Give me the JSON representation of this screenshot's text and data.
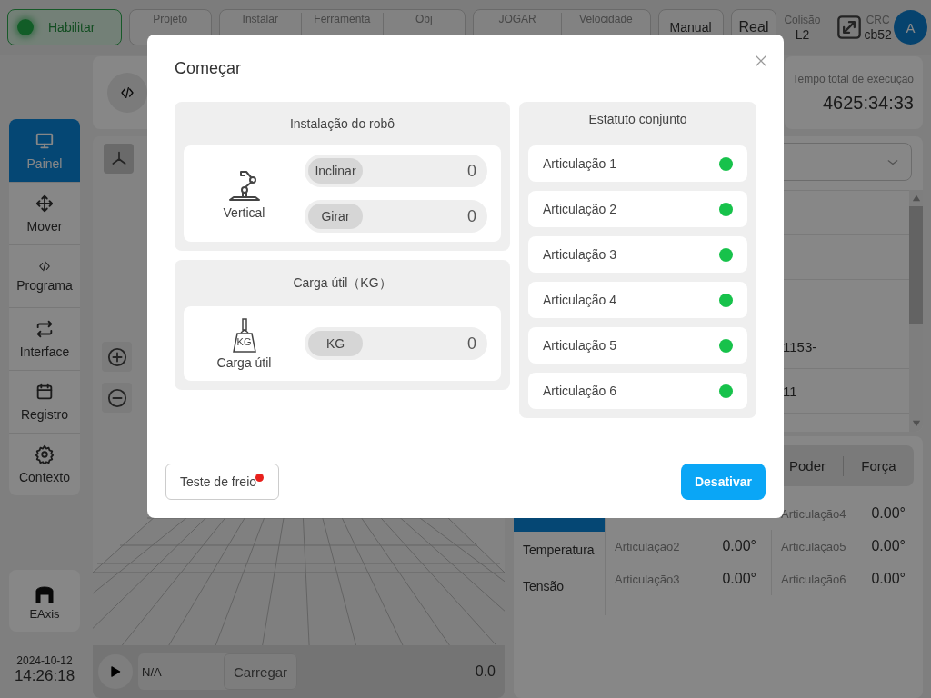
{
  "top_bar": {
    "enable_button": {
      "label": "Habilitar"
    },
    "status_groups": [
      {
        "items": [
          {
            "label": "Projeto"
          }
        ]
      },
      {
        "items": [
          {
            "label": "Instalar"
          },
          {
            "label": "Ferramenta"
          },
          {
            "label": "Obj"
          }
        ]
      },
      {
        "items": [
          {
            "label": "JOGAR"
          },
          {
            "label": "Velocidade"
          }
        ]
      }
    ],
    "mode_buttons": [
      "Manual",
      "Real"
    ],
    "collision": {
      "label": "Colisão",
      "value": "L2"
    },
    "crc": {
      "label": "CRC",
      "value": "cb52"
    },
    "avatar": "A"
  },
  "sidebar": {
    "items": [
      {
        "label": "Painel",
        "selected": true
      },
      {
        "label": "Mover",
        "selected": false
      },
      {
        "label": "Programa",
        "selected": false
      },
      {
        "label": "Interface",
        "selected": false
      },
      {
        "label": "Registro",
        "selected": false
      },
      {
        "label": "Contexto",
        "selected": false
      }
    ],
    "eaxis": "EAxis",
    "date": "2024-10-12",
    "time": "14:26:18"
  },
  "runtime": {
    "label": "Tempo total de execução",
    "value": "4625:34:33"
  },
  "viewport": {
    "program_field": "N/A",
    "load_button": "Carregar",
    "speed": "0.0"
  },
  "program_list": {
    "rows": [
      {},
      {},
      {},
      {
        "text": "1153-"
      },
      {
        "text": "11"
      },
      {}
    ]
  },
  "data_panel": {
    "tabs": [
      "Poder",
      "Força"
    ],
    "side_tabs": [
      {
        "selected": true
      },
      {
        "label": "Temperatura",
        "selected": false
      },
      {
        "label": "Tensão",
        "selected": false
      }
    ],
    "joints": [
      {
        "name": "Articulação2",
        "value": "0.00°"
      },
      {
        "name": "Articulação3",
        "value": "0.00°"
      },
      {
        "name": "Articulação4",
        "value": "0.00°"
      },
      {
        "name": "Articulação5",
        "value": "0.00°"
      },
      {
        "name": "Articulação6",
        "value": "0.00°"
      }
    ]
  },
  "dialog": {
    "title": "Começar",
    "installation": {
      "title": "Instalação do robô",
      "icon_label": "Vertical",
      "fields": [
        {
          "label": "Inclinar",
          "value": "0"
        },
        {
          "label": "Girar",
          "value": "0"
        }
      ]
    },
    "payload": {
      "title": "Carga útil（KG）",
      "icon_text": "KG",
      "icon_label": "Carga útil",
      "fields": [
        {
          "label": "KG",
          "value": "0"
        }
      ]
    },
    "joint_status": {
      "title": "Estatuto conjunto",
      "joints": [
        {
          "name": "Articulação 1",
          "color": "#17c24b"
        },
        {
          "name": "Articulação 2",
          "color": "#17c24b"
        },
        {
          "name": "Articulação 3",
          "color": "#17c24b"
        },
        {
          "name": "Articulação 4",
          "color": "#17c24b"
        },
        {
          "name": "Articulação 5",
          "color": "#17c24b"
        },
        {
          "name": "Articulação 6",
          "color": "#17c24b"
        }
      ]
    },
    "brake_test": {
      "label": "Teste de freio",
      "alert": true
    },
    "disable_button": "Desativar"
  }
}
